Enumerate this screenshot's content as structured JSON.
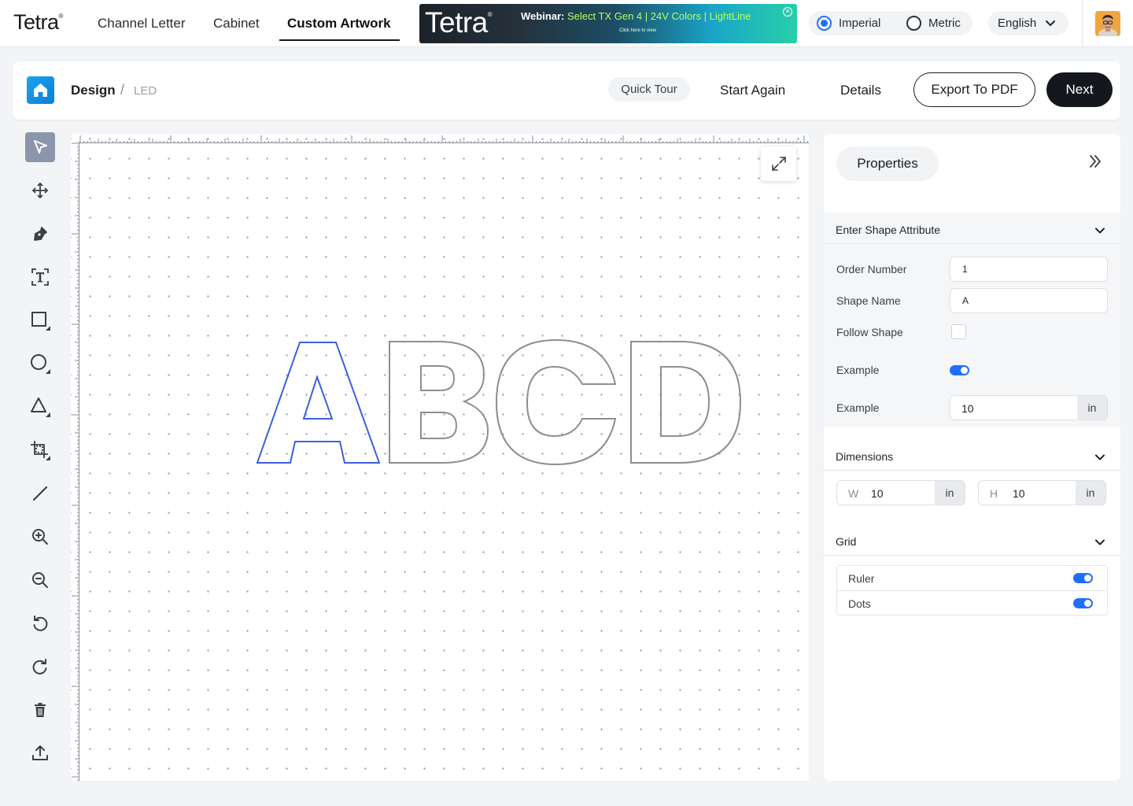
{
  "app": {
    "logo": "Tetra",
    "logo_mark": "®"
  },
  "nav": {
    "tabs": [
      {
        "label": "Channel Letter"
      },
      {
        "label": "Cabinet"
      },
      {
        "label": "Custom Artwork",
        "active": true
      }
    ]
  },
  "banner": {
    "brand": "Tetra",
    "brand_mark": "®",
    "title_prefix": "Webinar:",
    "title_highlight": "Select TX Gen 4 | 24V Colors | LightLine",
    "subtitle": "Click here to view",
    "close_glyph": "✕"
  },
  "units": {
    "options": [
      {
        "label": "Imperial",
        "selected": true
      },
      {
        "label": "Metric",
        "selected": false
      }
    ]
  },
  "language": {
    "selected": "English"
  },
  "header": {
    "breadcrumb": {
      "root": "Design",
      "separator": "/",
      "current": "LED"
    },
    "quick_tour": "Quick Tour",
    "start_again": "Start Again",
    "details": "Details",
    "export": "Export To PDF",
    "next": "Next"
  },
  "toolbar": {
    "tools": [
      {
        "icon": "pointer-icon",
        "active": true
      },
      {
        "icon": "move-icon"
      },
      {
        "icon": "pen-icon"
      },
      {
        "icon": "text-icon"
      },
      {
        "icon": "rectangle-icon"
      },
      {
        "icon": "circle-icon"
      },
      {
        "icon": "triangle-icon"
      },
      {
        "icon": "crop-icon"
      },
      {
        "icon": "line-icon"
      },
      {
        "icon": "zoom-in-icon"
      },
      {
        "icon": "zoom-out-icon"
      },
      {
        "icon": "undo-icon"
      },
      {
        "icon": "redo-icon"
      },
      {
        "icon": "trash-icon"
      },
      {
        "icon": "upload-icon"
      }
    ]
  },
  "canvas": {
    "artwork_text": "ABCD",
    "selected_letter": "A",
    "selection_color": "#3d5fe0",
    "outline_color": "#8e8e8e",
    "ruler": true,
    "dots": true
  },
  "panel": {
    "tab": "Properties",
    "shape_attribute": {
      "title": "Enter Shape Attribute",
      "order_number_label": "Order Number",
      "order_number_value": "1",
      "shape_name_label": "Shape Name",
      "shape_name_value": "A",
      "follow_shape_label": "Follow Shape",
      "follow_shape_checked": false,
      "example_toggle_label": "Example",
      "example_toggle_on": true,
      "example_input_label": "Example",
      "example_input_value": "10",
      "example_input_unit": "in"
    },
    "dimensions": {
      "title": "Dimensions",
      "w_prefix": "W",
      "w_value": "10",
      "w_unit": "in",
      "h_prefix": "H",
      "h_value": "10",
      "h_unit": "in"
    },
    "grid": {
      "title": "Grid",
      "ruler_label": "Ruler",
      "ruler_on": true,
      "dots_label": "Dots",
      "dots_on": true
    }
  },
  "colors": {
    "accent": "#1f6fff",
    "primary_button": "#14171b",
    "tool_active": "#8b95ac"
  }
}
